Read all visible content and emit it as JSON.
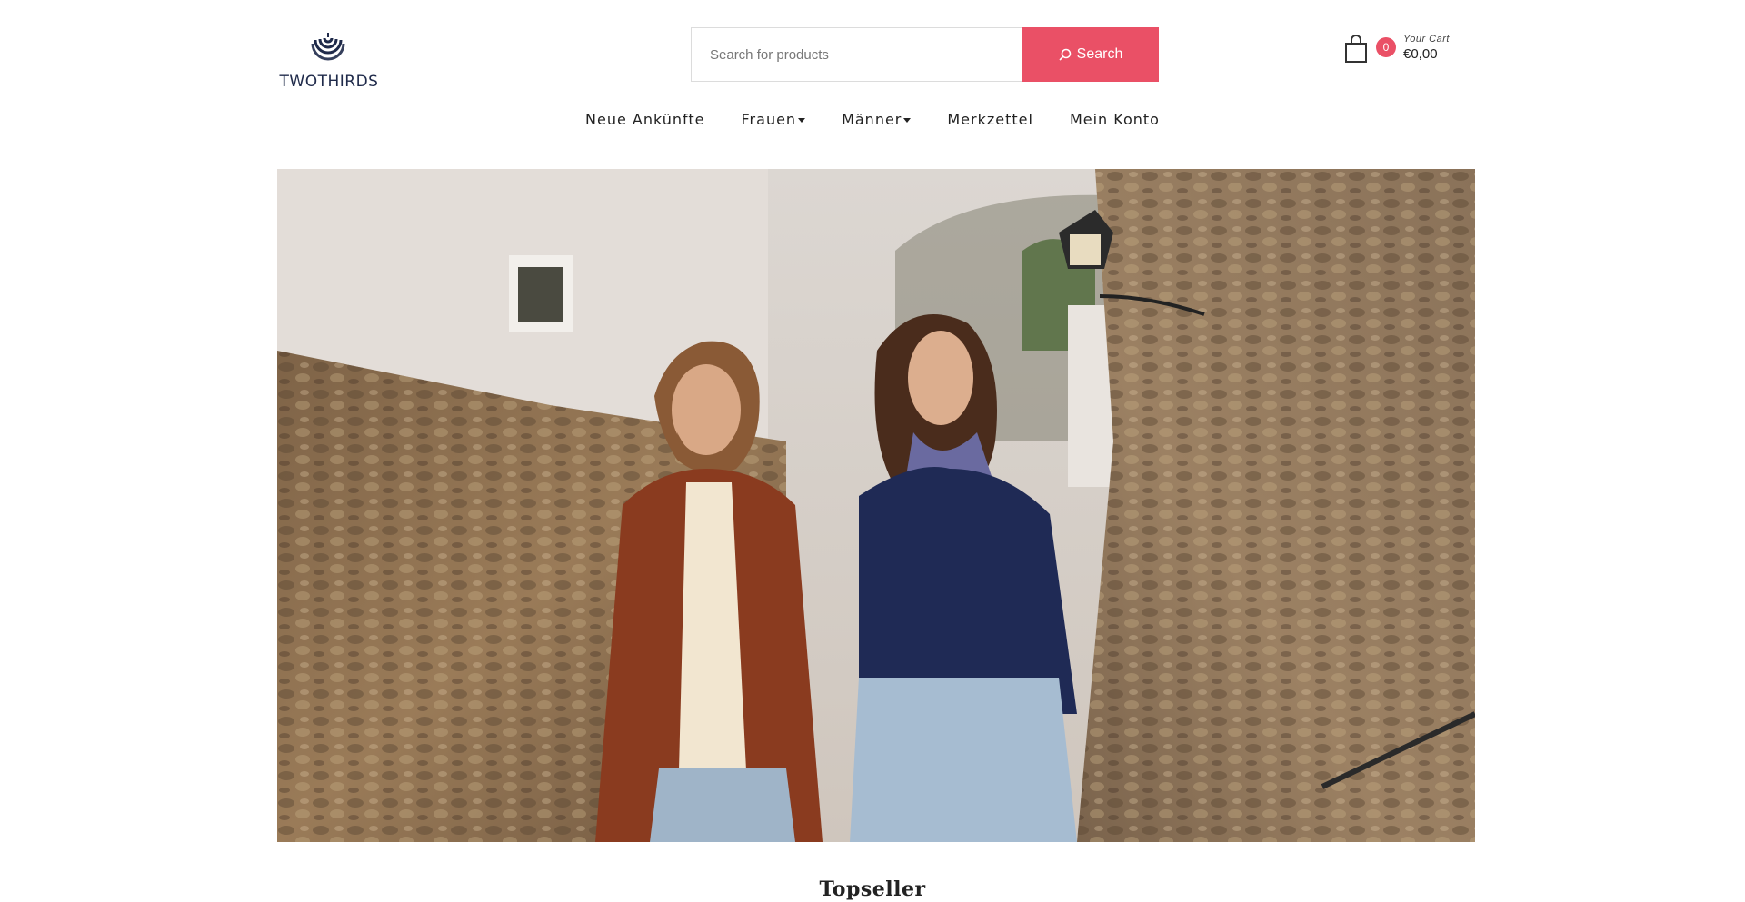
{
  "header": {
    "logo_text": "TWOTHIRDS",
    "logo_icon": "twothirds-spiral-logo",
    "search": {
      "placeholder": "Search for products",
      "button_label": "Search",
      "button_icon": "search-icon"
    },
    "cart": {
      "icon": "shopping-bag-icon",
      "count": "0",
      "label": "Your Cart",
      "total": "€0,00"
    }
  },
  "nav": {
    "items": [
      {
        "label": "Neue Ankünfte",
        "has_dropdown": false
      },
      {
        "label": "Frauen",
        "has_dropdown": true
      },
      {
        "label": "Männer",
        "has_dropdown": true
      },
      {
        "label": "Merkzettel",
        "has_dropdown": false
      },
      {
        "label": "Mein Konto",
        "has_dropdown": false
      }
    ]
  },
  "hero": {
    "image": "couple-walking-stone-alley-photo"
  },
  "sections": {
    "topseller_title": "Topseller"
  },
  "colors": {
    "accent": "#ea5066",
    "logo": "#1f2a4a"
  }
}
